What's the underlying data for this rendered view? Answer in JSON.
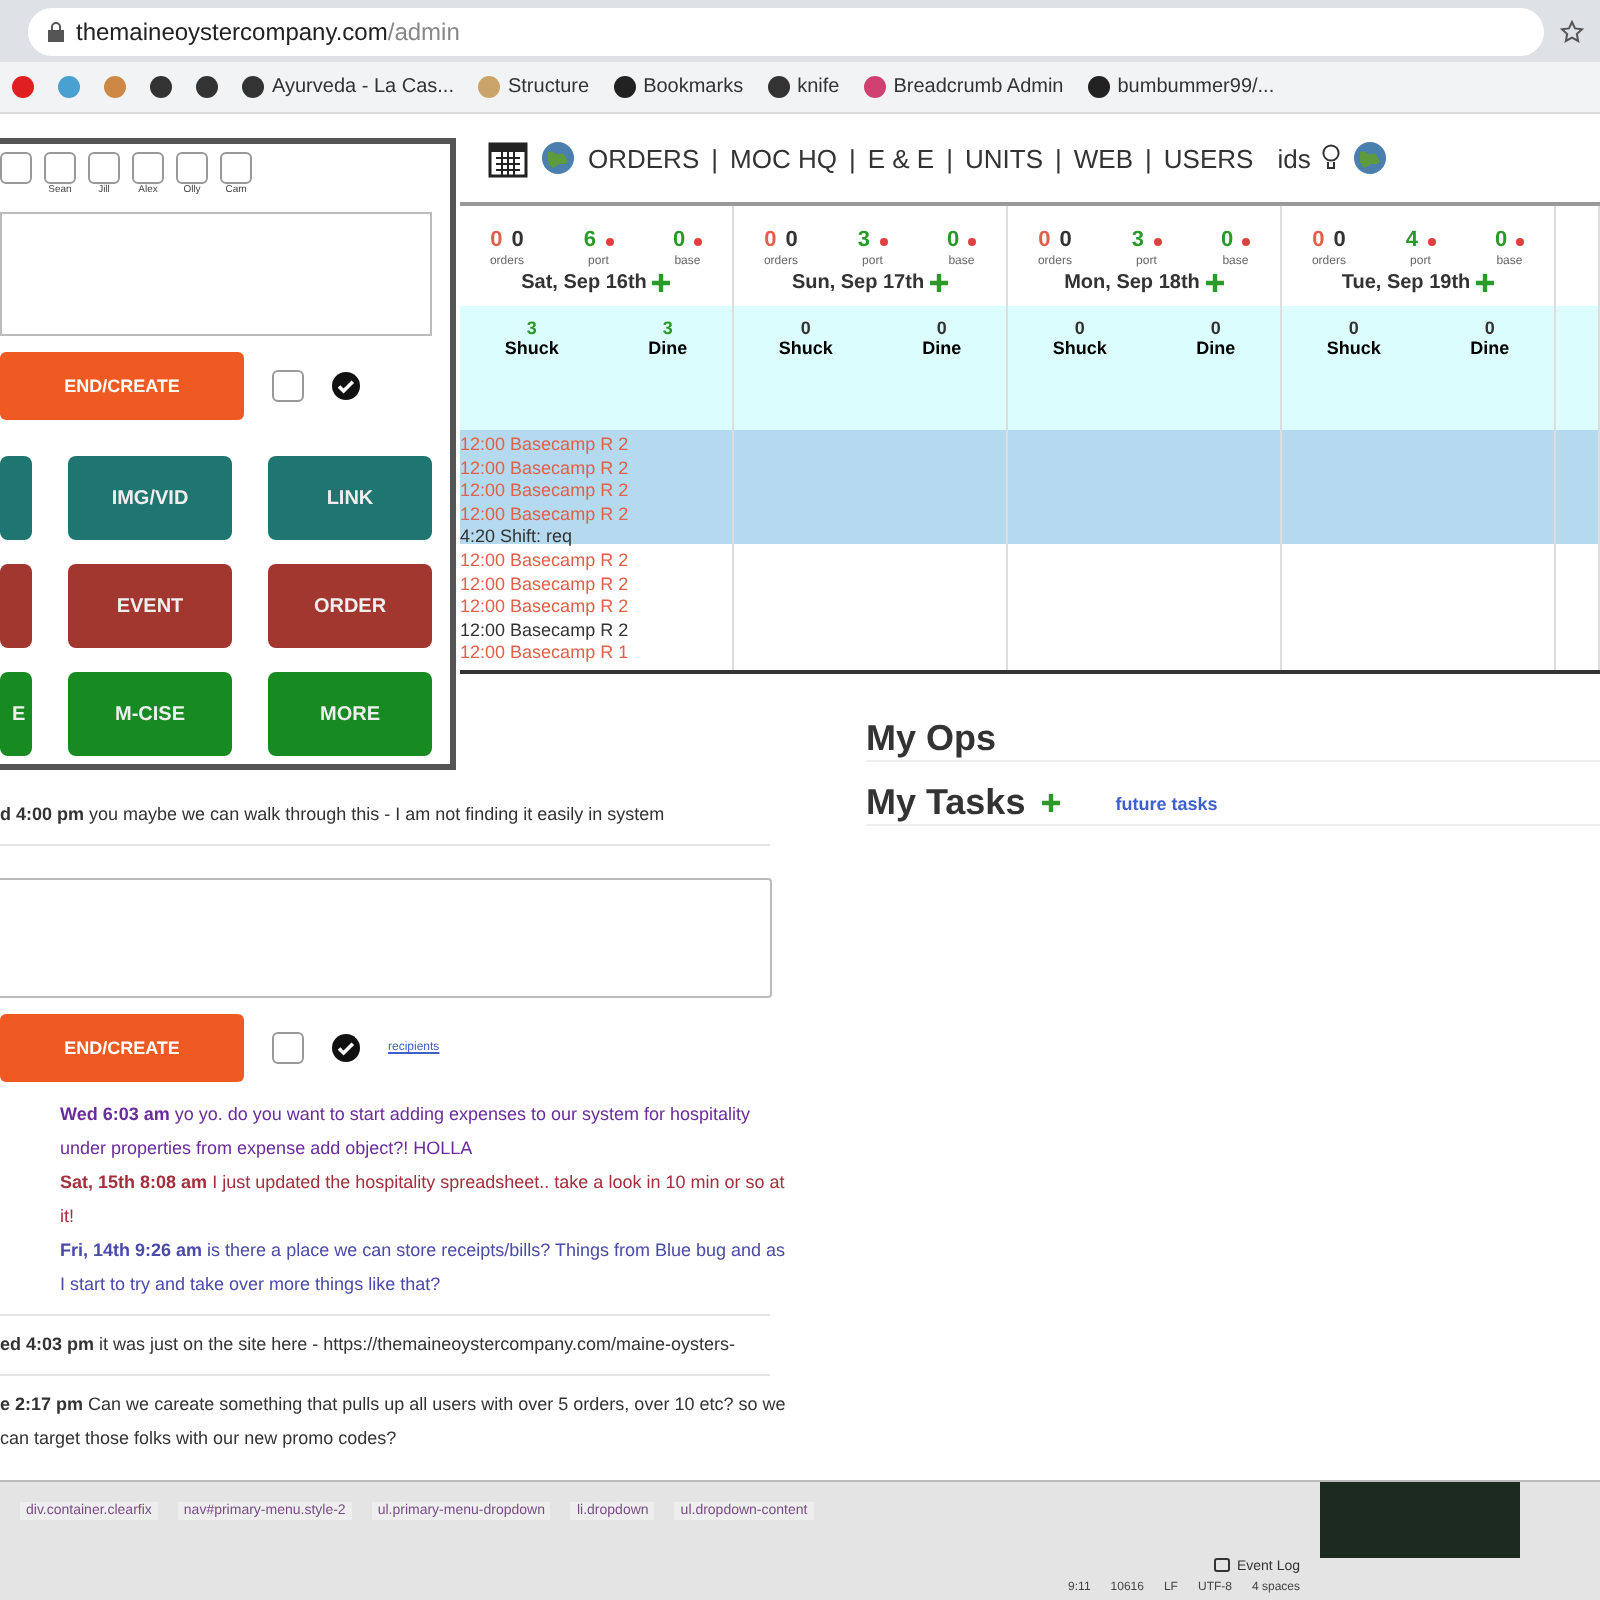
{
  "browser": {
    "url_host": "themaineoystercompany.com",
    "url_path": "/admin",
    "bookmarks": [
      {
        "label": "Ayurveda - La Cas..."
      },
      {
        "label": "Structure"
      },
      {
        "label": "Bookmarks"
      },
      {
        "label": "knife"
      },
      {
        "label": "Breadcrumb Admin"
      },
      {
        "label": "bumbummer99/..."
      }
    ]
  },
  "nav": {
    "links": [
      "ORDERS",
      "MOC HQ",
      "E & E",
      "UNITS",
      "WEB",
      "USERS"
    ],
    "separator": "|",
    "extra": "ids"
  },
  "calendar": {
    "days": [
      {
        "date": "Sat, Sep 16th",
        "orders": [
          "0",
          "0"
        ],
        "orders_label": "orders",
        "port": "6",
        "port_label": "port",
        "base": "0",
        "base_label": "base",
        "shuck": "3",
        "shuck_label": "Shuck",
        "dine": "3",
        "dine_label": "Dine",
        "events": [
          {
            "time": "12:00",
            "title": "Basecamp R 2",
            "kind": "highlighted"
          },
          {
            "time": "12:00",
            "title": "Basecamp R 2",
            "kind": "highlighted"
          },
          {
            "time": "12:00",
            "title": "Basecamp R 2",
            "kind": "highlighted"
          },
          {
            "time": "12:00",
            "title": "Basecamp R 2",
            "kind": "highlighted"
          },
          {
            "time": "4:20",
            "title": "Shift: req",
            "kind": "shift"
          },
          {
            "time": "12:00",
            "title": "Basecamp R 2",
            "kind": "normal"
          },
          {
            "time": "12:00",
            "title": "Basecamp R 2",
            "kind": "normal"
          },
          {
            "time": "12:00",
            "title": "Basecamp R 2",
            "kind": "normal"
          },
          {
            "time": "12:00",
            "title": "Basecamp R 2",
            "kind": "shift"
          },
          {
            "time": "12:00",
            "title": "Basecamp R 1",
            "kind": "normal"
          }
        ]
      },
      {
        "date": "Sun, Sep 17th",
        "orders": [
          "0",
          "0"
        ],
        "orders_label": "orders",
        "port": "3",
        "port_label": "port",
        "base": "0",
        "base_label": "base",
        "shuck": "0",
        "shuck_label": "Shuck",
        "dine": "0",
        "dine_label": "Dine"
      },
      {
        "date": "Mon, Sep 18th",
        "orders": [
          "0",
          "0"
        ],
        "orders_label": "orders",
        "port": "3",
        "port_label": "port",
        "base": "0",
        "base_label": "base",
        "shuck": "0",
        "shuck_label": "Shuck",
        "dine": "0",
        "dine_label": "Dine"
      },
      {
        "date": "Tue, Sep 19th",
        "orders": [
          "0",
          "0"
        ],
        "orders_label": "orders",
        "port": "4",
        "port_label": "port",
        "base": "0",
        "base_label": "base",
        "shuck": "0",
        "shuck_label": "Shuck",
        "dine": "0",
        "dine_label": "Dine"
      }
    ]
  },
  "messages_top": {
    "time": "d 4:00 pm",
    "text": "you maybe we can walk through this - I am not finding it easily in system"
  },
  "composer": {
    "send": "END/CREATE",
    "notify_checked": false,
    "link": "recipients"
  },
  "messages": [
    {
      "time": "Wed 6:03 am",
      "text": "yo yo. do you want to start adding expenses to our system for hospitality under properties from expense add object?! HOLLA",
      "color": "#6a2c9a",
      "indented": true
    },
    {
      "time": "Sat, 15th 8:08 am",
      "text": "I just updated the hospitality spreadsheet.. take a look in 10 min or so at it!",
      "color": "#a3303c",
      "indented": true
    },
    {
      "time": "Fri, 14th 9:26 am",
      "text": "is there a place we can store receipts/bills? Things from Blue bug and as I start to try and take over more things like that?",
      "color": "#4a4aa8",
      "indented": true
    },
    {
      "time": "ed 4:03 pm",
      "text": "it was just on the site here - https://themaineoystercompany.com/maine-oysters-",
      "color": "#333333",
      "indented": false
    },
    {
      "time": "e 2:17 pm",
      "text": "Can we careate something that pulls up all users with over 5 orders, over 10 etc? so we can target those folks with our new promo codes?",
      "color": "#333333",
      "indented": false
    }
  ],
  "right": {
    "ops_title": "My Ops",
    "tasks_title": "My Tasks",
    "tasks_link": "future tasks"
  },
  "popup": {
    "recipients": [
      {
        "checked": false
      },
      {
        "name": "Sean",
        "checked": false
      },
      {
        "name": "Jill",
        "checked": false
      },
      {
        "name": "Alex",
        "checked": false
      },
      {
        "name": "Olly",
        "checked": false
      },
      {
        "name": "Cam",
        "checked": false
      }
    ],
    "send": "END/CREATE",
    "notify_checked": false,
    "buttons": [
      {
        "kind": "media"
      },
      {
        "label": "IMG/VID",
        "kind": "media"
      },
      {
        "label": "LINK",
        "kind": "media"
      },
      {
        "kind": "event"
      },
      {
        "label": "EVENT",
        "kind": "event"
      },
      {
        "label": "ORDER",
        "kind": "event"
      },
      {
        "label": "E",
        "kind": "exercise"
      },
      {
        "label": "M-CISE",
        "kind": "exercise"
      },
      {
        "label": "MORE",
        "kind": "exercise"
      }
    ]
  },
  "ide": {
    "breadcrumbs": [
      "div.container.clearfix",
      "nav#primary-menu.style-2",
      "ul.primary-menu-dropdown",
      "li.dropdown",
      "ul.dropdown-content"
    ],
    "event_log": "Event Log",
    "status": [
      "9:11",
      "10616",
      "LF",
      "UTF-8",
      "4 spaces"
    ]
  }
}
